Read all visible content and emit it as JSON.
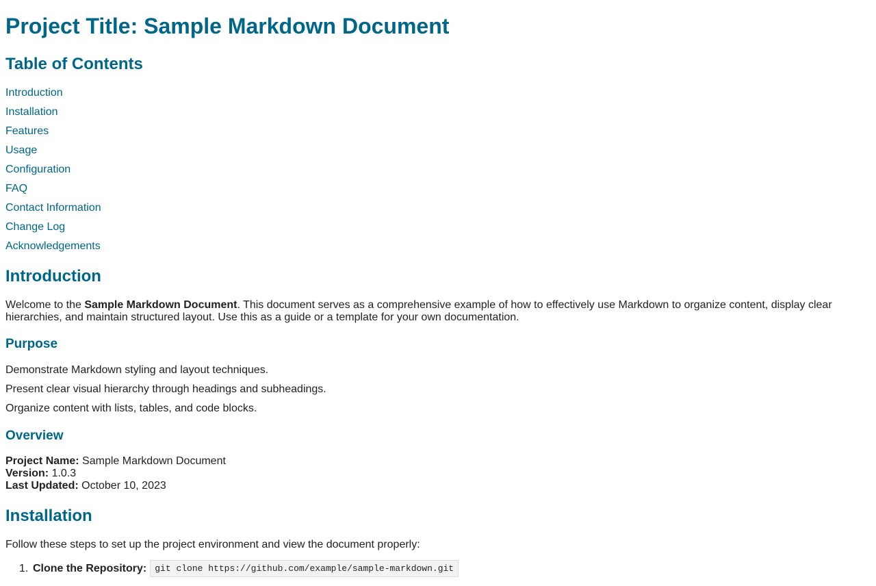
{
  "title": "Project Title: Sample Markdown Document",
  "toc": {
    "heading": "Table of Contents",
    "items": [
      "Introduction",
      "Installation",
      "Features",
      "Usage",
      "Configuration",
      "FAQ",
      "Contact Information",
      "Change Log",
      "Acknowledgements"
    ]
  },
  "introduction": {
    "heading": "Introduction",
    "text_before": "Welcome to the ",
    "bold": "Sample Markdown Document",
    "text_after": ". This document serves as a comprehensive example of how to effectively use Markdown to organize content, display clear hierarchies, and maintain structured layout. Use this as a guide or a template for your own documentation."
  },
  "purpose": {
    "heading": "Purpose",
    "items": [
      "Demonstrate Markdown styling and layout techniques.",
      "Present clear visual hierarchy through headings and subheadings.",
      "Organize content with lists, tables, and code blocks."
    ]
  },
  "overview": {
    "heading": "Overview",
    "rows": [
      {
        "label": "Project Name:",
        "value": " Sample Markdown Document"
      },
      {
        "label": "Version:",
        "value": " 1.0.3"
      },
      {
        "label": "Last Updated:",
        "value": " October 10, 2023"
      }
    ]
  },
  "installation": {
    "heading": "Installation",
    "intro": "Follow these steps to set up the project environment and view the document properly:",
    "steps": [
      {
        "number": "1.",
        "label": "Clone the Repository:",
        "code": "git clone https://github.com/example/sample-markdown.git"
      }
    ]
  },
  "colors": {
    "heading": "#006688",
    "text": "#222222"
  }
}
